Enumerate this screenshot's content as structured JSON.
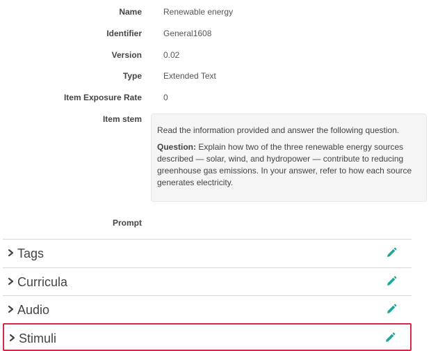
{
  "details": {
    "name": {
      "label": "Name",
      "value": "Renewable energy"
    },
    "identifier": {
      "label": "Identifier",
      "value": "General1608"
    },
    "version": {
      "label": "Version",
      "value": "0.02"
    },
    "type": {
      "label": "Type",
      "value": "Extended Text"
    },
    "exposure": {
      "label": "Item Exposure Rate",
      "value": "0"
    },
    "stem": {
      "label": "Item stem",
      "intro": "Read the information provided and answer the following question.",
      "question_label": "Question:",
      "question_text": "Explain how two of the three renewable energy sources described — solar, wind, and hydropower — contribute to reducing greenhouse gas emissions. In your answer, refer to how each source generates electricity."
    },
    "prompt": {
      "label": "Prompt"
    }
  },
  "sections": [
    {
      "title": "Tags",
      "icon": "pencil-icon"
    },
    {
      "title": "Curricula",
      "icon": "pencil-icon"
    },
    {
      "title": "Audio",
      "icon": "pencil-icon"
    },
    {
      "title": "Stimuli",
      "icon": "pencil-icon"
    }
  ],
  "colors": {
    "accent": "#1aa89a",
    "highlight": "#d9264a",
    "stem_background": "#f5f5f5"
  }
}
